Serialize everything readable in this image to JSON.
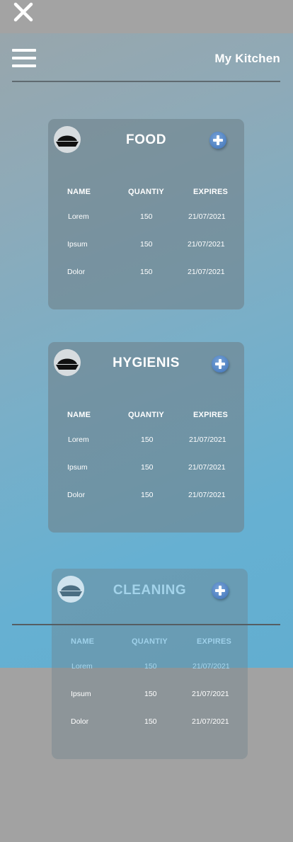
{
  "header": {
    "close_icon": "close-icon",
    "menu_icon": "hamburger-menu-icon",
    "title": "My Kitchen"
  },
  "colors": {
    "accent": "#4e80c1",
    "screen_top": "#98a6ac",
    "screen_bottom": "#62aed0",
    "card": "#70828c"
  },
  "cards": [
    {
      "title": "FOOD",
      "icon": "food-bowl-icon",
      "add_icon": "plus-icon",
      "headers": [
        "NAME",
        "QUANTIY",
        "EXPIRES"
      ],
      "rows": [
        {
          "name": "Lorem",
          "quantity": "150",
          "expires": "21/07/2021"
        },
        {
          "name": "Ipsum",
          "quantity": "150",
          "expires": "21/07/2021"
        },
        {
          "name": "Dolor",
          "quantity": "150",
          "expires": "21/07/2021"
        }
      ]
    },
    {
      "title": "HYGIENIS",
      "icon": "food-bowl-icon",
      "add_icon": "plus-icon",
      "headers": [
        "NAME",
        "QUANTIY",
        "EXPIRES"
      ],
      "rows": [
        {
          "name": "Lorem",
          "quantity": "150",
          "expires": "21/07/2021"
        },
        {
          "name": "Ipsum",
          "quantity": "150",
          "expires": "21/07/2021"
        },
        {
          "name": "Dolor",
          "quantity": "150",
          "expires": "21/07/2021"
        }
      ]
    },
    {
      "title": "CLEANING",
      "icon": "food-bowl-icon",
      "add_icon": "plus-icon",
      "headers": [
        "NAME",
        "QUANTIY",
        "EXPIRES"
      ],
      "rows": [
        {
          "name": "Lorem",
          "quantity": "150",
          "expires": "21/07/2021"
        },
        {
          "name": "Ipsum",
          "quantity": "150",
          "expires": "21/07/2021"
        },
        {
          "name": "Dolor",
          "quantity": "150",
          "expires": "21/07/2021"
        }
      ]
    }
  ]
}
